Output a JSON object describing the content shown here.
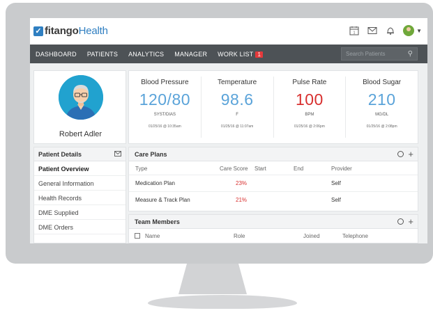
{
  "app": {
    "logo_prefix": "fitango",
    "logo_suffix": "Health",
    "calendar_day": "1"
  },
  "nav": {
    "items": [
      "DASHBOARD",
      "PATIENTS",
      "ANALYTICS",
      "MANAGER",
      "WORK LIST"
    ],
    "worklist_badge": "1",
    "search_placeholder": "Search Patients"
  },
  "patient": {
    "name": "Robert Adler"
  },
  "vitals": [
    {
      "label": "Blood Pressure",
      "value": "120/80",
      "unit": "SYST/DIAS",
      "time": "01/25/16 @ 10:35am",
      "color": "#5aa3d9"
    },
    {
      "label": "Temperature",
      "value": "98.6",
      "unit": "F",
      "time": "01/25/16 @ 11:07am",
      "color": "#5aa3d9"
    },
    {
      "label": "Pulse Rate",
      "value": "100",
      "unit": "BPM",
      "time": "01/25/16 @ 2:06pm",
      "color": "#d8302f"
    },
    {
      "label": "Blood Sugar",
      "value": "210",
      "unit": "MG/DL",
      "time": "01/25/16 @ 2:08pm",
      "color": "#5aa3d9"
    }
  ],
  "side_menu": {
    "title": "Patient Details",
    "items": [
      "Patient Overview",
      "General Information",
      "Health Records",
      "DME Supplied",
      "DME Orders"
    ]
  },
  "care_plans": {
    "title": "Care Plans",
    "columns": [
      "Type",
      "Care Score",
      "Start",
      "End",
      "Provider"
    ],
    "rows": [
      {
        "type": "Medication Plan",
        "score": "23%",
        "start": "",
        "end": "",
        "provider": "Self"
      },
      {
        "type": "Measure & Track Plan",
        "score": "21%",
        "start": "",
        "end": "",
        "provider": "Self"
      }
    ]
  },
  "team_members": {
    "title": "Team Members",
    "columns": [
      "Name",
      "Role",
      "Joined",
      "Telephone"
    ]
  }
}
